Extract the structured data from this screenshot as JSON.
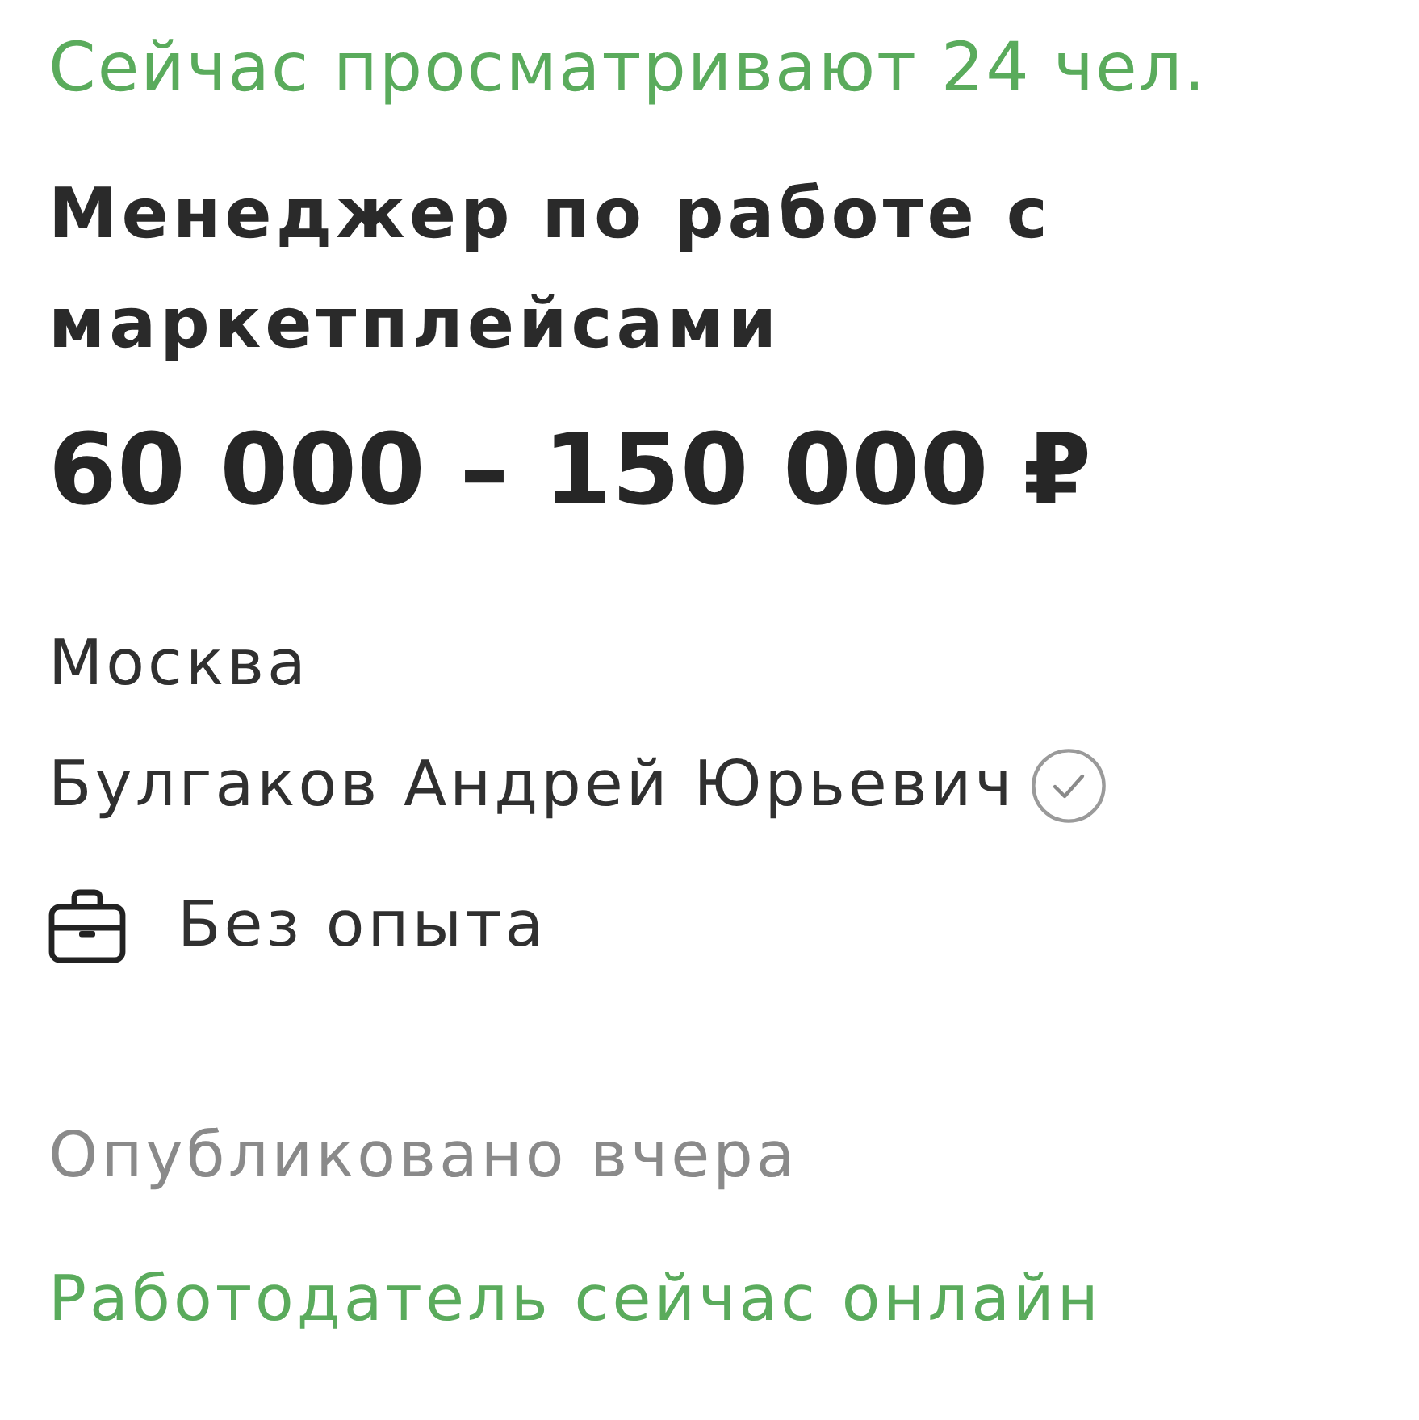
{
  "viewers": "Сейчас просматривают 24 чел.",
  "title": "Менеджер по работе с маркетплейсами",
  "salary": "60 000 – 150 000 ₽",
  "city": "Москва",
  "employer": {
    "name": "Булгаков Андрей Юрьевич",
    "verified": true
  },
  "experience": "Без опыта",
  "published": "Опубликовано вчера",
  "employer_status": "Работодатель сейчас онлайн"
}
